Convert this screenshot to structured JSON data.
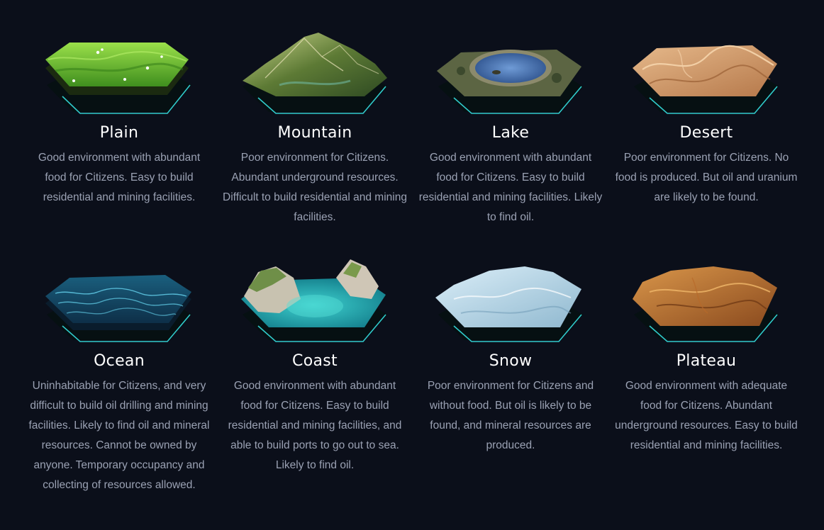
{
  "terrains": [
    {
      "key": "plain",
      "name": "Plain",
      "description": "Good environment with abundant food for Citizens. Easy to build residential and mining facilities.",
      "icon": "plain-terrain-tile"
    },
    {
      "key": "mountain",
      "name": "Mountain",
      "description": "Poor environment for Citizens. Abundant underground resources. Difficult to build residential and mining facilities.",
      "icon": "mountain-terrain-tile"
    },
    {
      "key": "lake",
      "name": "Lake",
      "description": "Good environment with abundant food for Citizens. Easy to build residential and mining facilities. Likely to find oil.",
      "icon": "lake-terrain-tile"
    },
    {
      "key": "desert",
      "name": "Desert",
      "description": "Poor environment for Citizens. No food is produced. But oil and uranium are likely to be found.",
      "icon": "desert-terrain-tile"
    },
    {
      "key": "ocean",
      "name": "Ocean",
      "description": "Uninhabitable for Citizens, and very difficult to build oil drilling and mining facilities. Likely to find oil and mineral resources. Cannot be owned by anyone. Temporary occupancy and collecting of resources allowed.",
      "icon": "ocean-terrain-tile"
    },
    {
      "key": "coast",
      "name": "Coast",
      "description": "Good environment with abundant food for Citizens. Easy to build residential and mining facilities, and able to build ports to go out to sea. Likely to find oil.",
      "icon": "coast-terrain-tile"
    },
    {
      "key": "snow",
      "name": "Snow",
      "description": "Poor environment for Citizens and without food. But oil is likely to be found, and mineral resources are produced.",
      "icon": "snow-terrain-tile"
    },
    {
      "key": "plateau",
      "name": "Plateau",
      "description": "Good environment with adequate food for Citizens. Abundant underground resources. Easy to build residential and mining facilities.",
      "icon": "plateau-terrain-tile"
    }
  ],
  "colors": {
    "background": "#0b0f1a",
    "title": "#ffffff",
    "description": "#9aa1b3",
    "rim_glow": "#35e0e0"
  }
}
